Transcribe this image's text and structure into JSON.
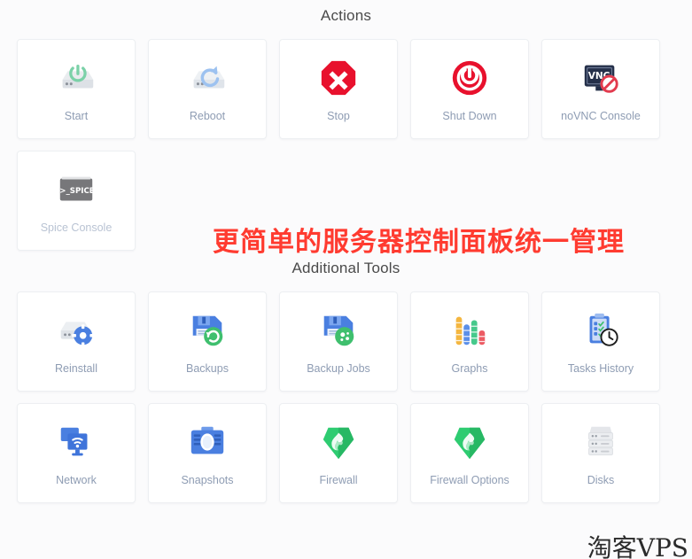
{
  "sections": [
    {
      "id": "actions",
      "title": "Actions",
      "items": [
        {
          "label": "Start",
          "icon": "server-power-start-icon",
          "muted": false
        },
        {
          "label": "Reboot",
          "icon": "server-reboot-icon",
          "muted": false
        },
        {
          "label": "Stop",
          "icon": "stop-octagon-icon",
          "muted": false
        },
        {
          "label": "Shut Down",
          "icon": "power-off-icon",
          "muted": false
        },
        {
          "label": "noVNC Console",
          "icon": "vnc-monitor-blocked-icon",
          "muted": false
        },
        {
          "label": "Spice Console",
          "icon": "spice-terminal-icon",
          "muted": true
        }
      ]
    },
    {
      "id": "additional-tools",
      "title": "Additional Tools",
      "items": [
        {
          "label": "Reinstall",
          "icon": "server-gear-icon",
          "muted": false
        },
        {
          "label": "Backups",
          "icon": "floppy-restore-icon",
          "muted": false
        },
        {
          "label": "Backup Jobs",
          "icon": "floppy-gear-icon",
          "muted": false
        },
        {
          "label": "Graphs",
          "icon": "bar-chart-icon",
          "muted": false
        },
        {
          "label": "Tasks History",
          "icon": "clipboard-clock-icon",
          "muted": false
        },
        {
          "label": "Network",
          "icon": "network-wifi-icon",
          "muted": false
        },
        {
          "label": "Snapshots",
          "icon": "camera-icon",
          "muted": false
        },
        {
          "label": "Firewall",
          "icon": "shield-flame-icon",
          "muted": false
        },
        {
          "label": "Firewall Options",
          "icon": "shield-flame-icon",
          "muted": false
        },
        {
          "label": "Disks",
          "icon": "disks-stack-icon",
          "muted": false
        }
      ]
    }
  ],
  "banner": {
    "text": "更简单的服务器控制面板统一管理",
    "color": "#ff3b30"
  },
  "watermark": {
    "text": "淘客VPS"
  },
  "colors": {
    "page_background": "#fbfbfc",
    "card_background": "#ffffff",
    "card_border": "#edeff2",
    "label": "#8e9cb3",
    "label_muted": "#b9c3d3",
    "heading": "#4a4a4a",
    "danger": "#e8112d",
    "accent_blue": "#4a7fe0",
    "accent_green": "#2ecc71"
  }
}
